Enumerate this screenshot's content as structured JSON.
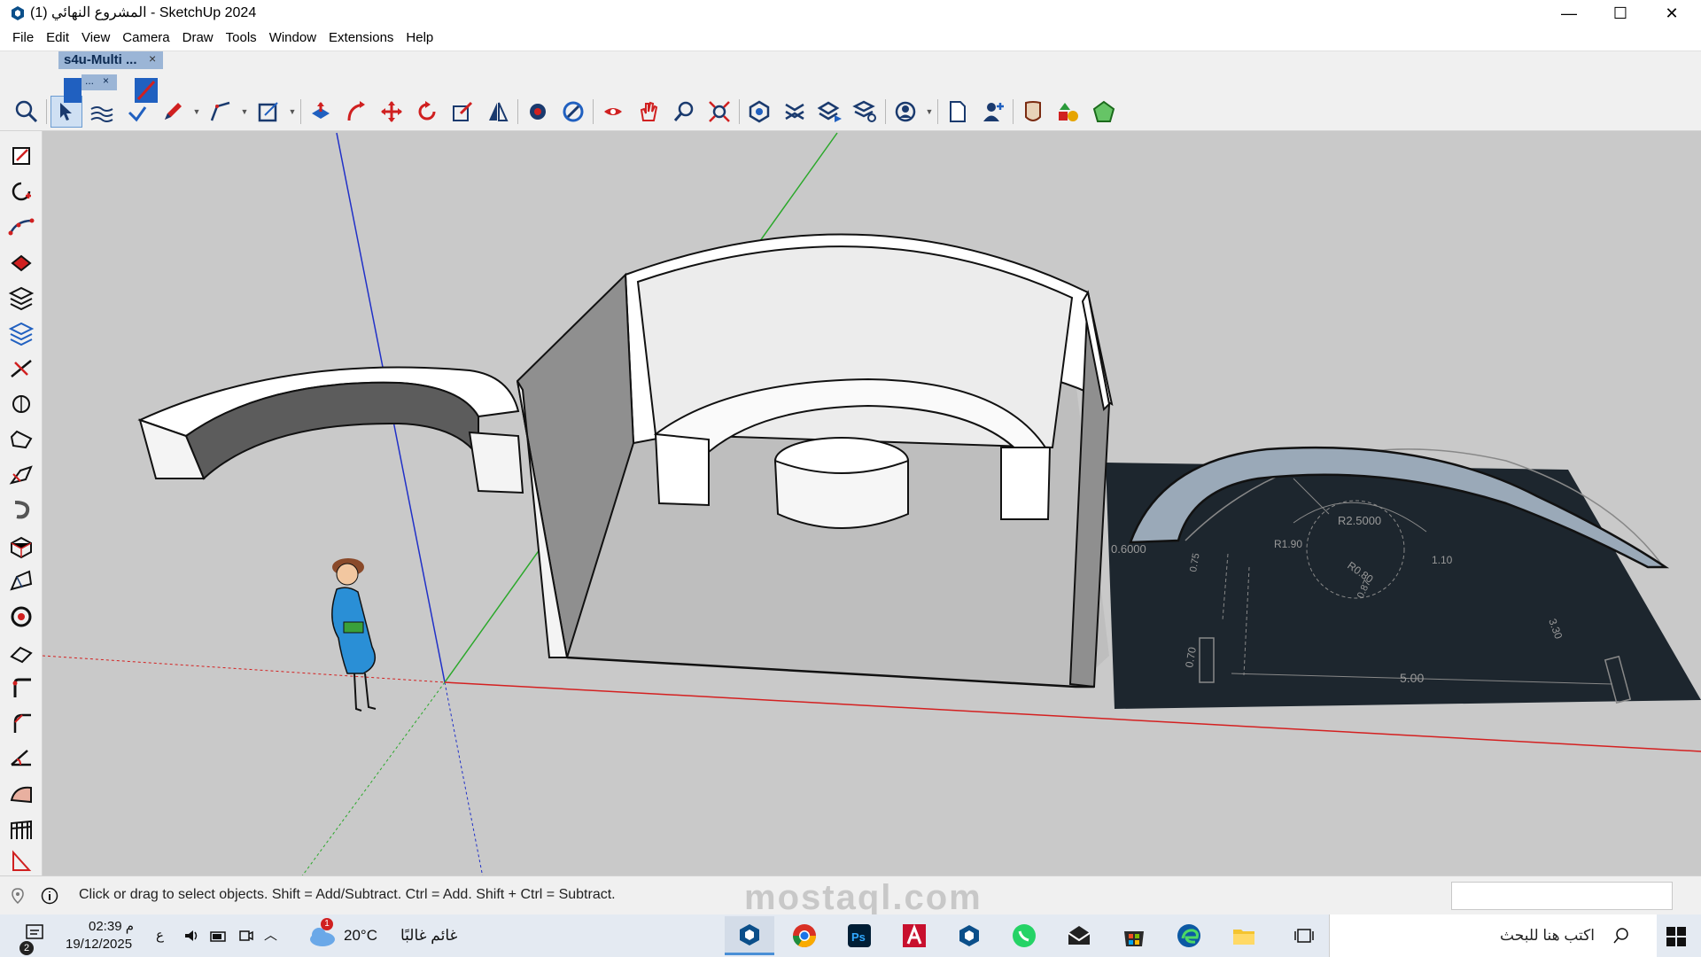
{
  "window": {
    "title": "المشروع النهائي (1) - SketchUp 2024",
    "controls": [
      "—",
      "☐",
      "✕"
    ]
  },
  "menu": [
    "File",
    "Edit",
    "View",
    "Camera",
    "Draw",
    "Tools",
    "Window",
    "Extensions",
    "Help"
  ],
  "floating_panel": {
    "title": "s4u-Multi ...",
    "close": "×",
    "sub_title": "...",
    "sub_close": "×"
  },
  "toolbar": {
    "tools": [
      "zoom-tool",
      "select-tool",
      "line-tool",
      "pencil-tool",
      "polyline-tool",
      "rectangle-tool",
      "push-pull-tool",
      "follow-me-tool",
      "move-tool",
      "rotate-tool",
      "scale-tool",
      "flip-tool",
      "outer-shell-tool",
      "intersect-tool",
      "section-plane-tool",
      "orbit-tool",
      "pan-tool",
      "zoom-tool-2",
      "zoom-extents-tool",
      "warehouse-tool",
      "layers-tool",
      "tags-tool",
      "tag-settings-tool",
      "account-tool",
      "new-doc-tool",
      "profile-tool",
      "ruby-tool",
      "style-tool",
      "extension-tool"
    ]
  },
  "left_toolbar": [
    "arrow-select-icon",
    "circle-add-icon",
    "curve-icon",
    "paint-bucket-icon",
    "layers-stack-icon",
    "layers-stack-2-icon",
    "line-cut-icon",
    "rotate-3d-icon",
    "offset-icon",
    "smooth-icon",
    "hook-icon",
    "box-icon",
    "sandbox-icon",
    "gear-3d-icon",
    "edge-icon",
    "corner-icon",
    "arc-corner-icon",
    "angle-icon",
    "curve-surface-icon",
    "fence-icon",
    "triangle-icon"
  ],
  "drawing": {
    "dim_labels": [
      "R2.5000",
      "R1.90",
      "R0.80",
      "0.6000",
      "1.10",
      "5.00",
      "3.30",
      "0.70",
      "0.75",
      "0.87"
    ]
  },
  "status": {
    "message": "Click or drag to select objects. Shift = Add/Subtract. Ctrl = Add. Shift + Ctrl = Subtract.",
    "watermark": "mostaql.com"
  },
  "taskbar": {
    "notification_count": "2",
    "time": "02:39 م",
    "date": "19/12/2025",
    "lang": "ع",
    "weather_temp": "20°C",
    "weather_desc": "غائم غالبًا",
    "weather_badge": "1",
    "search_placeholder": "اكتب هنا للبحث",
    "apps": [
      "sketchup",
      "chrome",
      "photoshop",
      "autocad",
      "sketchup-2",
      "whatsapp",
      "mail",
      "store",
      "edge",
      "file-explorer",
      "task-view"
    ]
  },
  "colors": {
    "viewport_bg": "#c9c9c9",
    "axis_red": "#d42020",
    "axis_green": "#2aa82a",
    "axis_blue": "#2030c8",
    "panel_blue": "#9bb5d6",
    "cad_bg": "#1d262e"
  }
}
